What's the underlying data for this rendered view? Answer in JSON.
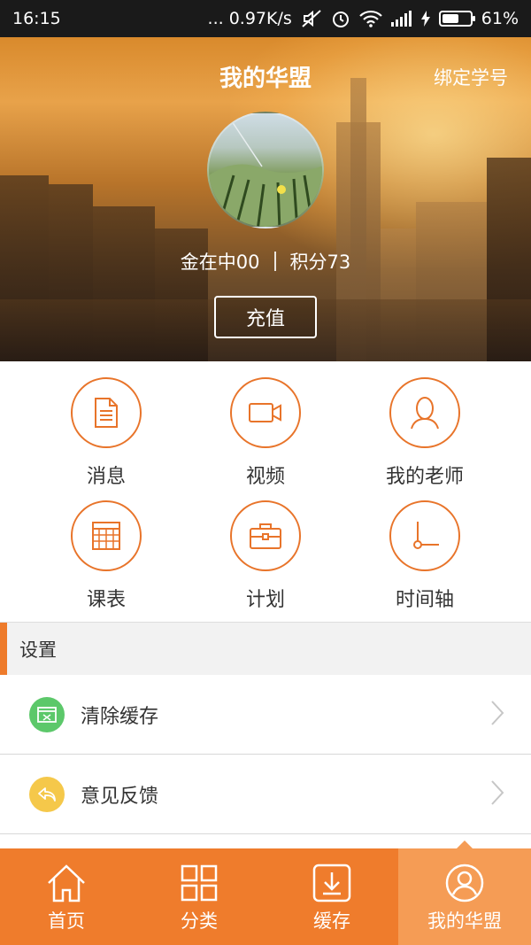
{
  "status_bar": {
    "time": "16:15",
    "network_speed": "... 0.97K/s",
    "battery_percent": "61%",
    "battery_level": 0.61
  },
  "header": {
    "title": "我的华盟",
    "bind_link": "绑定学号",
    "username": "金在中00",
    "points": "积分73",
    "recharge_button": "充值"
  },
  "grid": {
    "items": [
      {
        "label": "消息",
        "icon": "document-icon"
      },
      {
        "label": "视频",
        "icon": "video-camera-icon"
      },
      {
        "label": "我的老师",
        "icon": "person-icon"
      },
      {
        "label": "课表",
        "icon": "timetable-icon"
      },
      {
        "label": "计划",
        "icon": "briefcase-icon"
      },
      {
        "label": "时间轴",
        "icon": "clock-icon"
      }
    ]
  },
  "settings": {
    "section_title": "设置",
    "items": [
      {
        "label": "清除缓存",
        "icon": "clear-cache-icon",
        "color": "#5cc86a"
      },
      {
        "label": "意见反馈",
        "icon": "feedback-icon",
        "color": "#f5c84a"
      }
    ]
  },
  "tabbar": {
    "tabs": [
      {
        "label": "首页",
        "icon": "home-icon",
        "active": false
      },
      {
        "label": "分类",
        "icon": "category-grid-icon",
        "active": false
      },
      {
        "label": "缓存",
        "icon": "download-icon",
        "active": false
      },
      {
        "label": "我的华盟",
        "icon": "user-profile-icon",
        "active": true
      }
    ]
  },
  "colors": {
    "accent": "#ef7c2c",
    "accent_light": "#f59c55",
    "icon_stroke": "#e8742a"
  }
}
